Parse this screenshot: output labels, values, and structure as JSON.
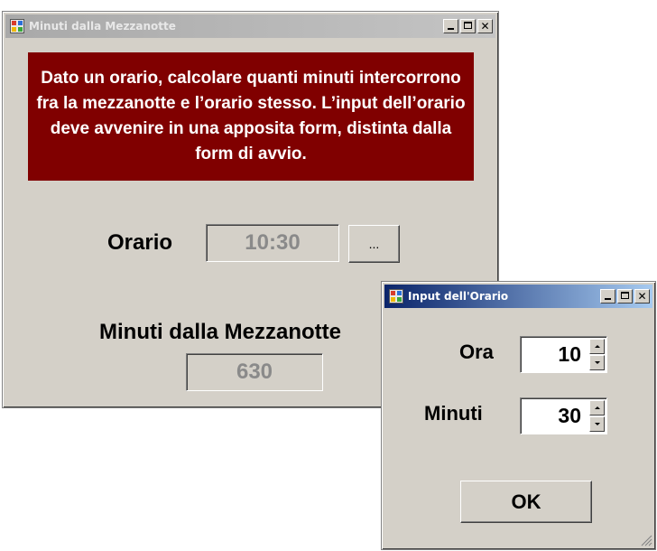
{
  "main_window": {
    "title": "Minuti dalla Mezzanotte",
    "banner_text": "Dato un orario, calcolare quanti minuti intercorrono fra la mezzanotte e l’orario stesso. L’input dell’orario deve avvenire in una apposita form, distinta dalla form di avvio.",
    "orario_label": "Orario",
    "orario_value": "10:30",
    "browse_button_label": "...",
    "minuti_label": "Minuti dalla Mezzanotte",
    "minuti_value": "630",
    "colors": {
      "banner_bg": "#800000",
      "window_bg": "#d4d0c8"
    }
  },
  "dialog": {
    "title": "Input dell'Orario",
    "ora_label": "Ora",
    "ora_value": "10",
    "minuti_label": "Minuti",
    "minuti_value": "30",
    "ok_label": "OK",
    "colors": {
      "titlebar_start": "#0a246a",
      "titlebar_end": "#a6caf0"
    }
  },
  "icons": [
    "app-icon",
    "minimize-icon",
    "maximize-icon",
    "close-icon",
    "spin-up-icon",
    "spin-down-icon",
    "size-grip-icon"
  ]
}
